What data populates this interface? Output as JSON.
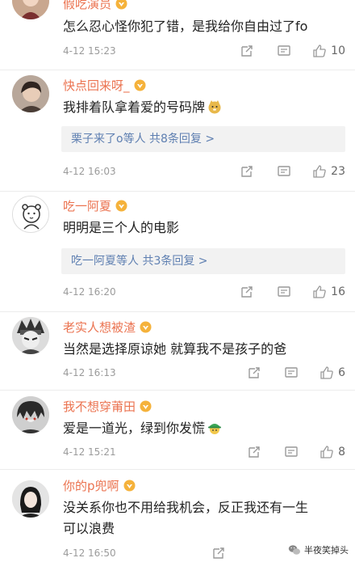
{
  "colors": {
    "username": "#eb7350",
    "reply_link": "#5e7fb1",
    "meta": "#9b9b9b",
    "badge": "#f5b23b"
  },
  "comments": [
    {
      "username": "假吃演员",
      "content": "怎么忍心怪你犯了错，是我给你自由过了fo",
      "time": "4-12 15:23",
      "likes": "10",
      "avatar_icon": "avatar-woman-icon"
    },
    {
      "username": "快点回来呀_",
      "content": "我排着队拿着爱的号码牌",
      "emoji": "doge-emoji-icon",
      "replies": "栗子来了o等人  共8条回复 >",
      "time": "4-12 16:03",
      "likes": "23",
      "avatar_icon": "avatar-girl-icon"
    },
    {
      "username": "吃一阿夏",
      "content": "明明是三个人的电影",
      "replies": "吃一阿夏等人  共3条回复 >",
      "time": "4-12 16:20",
      "likes": "16",
      "avatar_icon": "avatar-bear-icon"
    },
    {
      "username": "老实人想被渣",
      "content": "当然是选择原谅她 就算我不是孩子的爸",
      "time": "4-12 16:13",
      "likes": "6",
      "avatar_icon": "avatar-ninja-icon"
    },
    {
      "username": "我不想穿莆田",
      "content": "爱是一道光，绿到你发慌",
      "emoji": "green-hat-emoji-icon",
      "time": "4-12 15:21",
      "likes": "8",
      "avatar_icon": "avatar-anime-icon"
    },
    {
      "username": "你的p兜啊",
      "content": "没关系你也不用给我机会，反正我还有一生\n可以浪费",
      "time": "4-12 16:50",
      "likes": "",
      "avatar_icon": "avatar-portrait-icon"
    }
  ],
  "watermark": {
    "text": "半夜笑掉头",
    "icon": "wechat-logo-icon"
  }
}
